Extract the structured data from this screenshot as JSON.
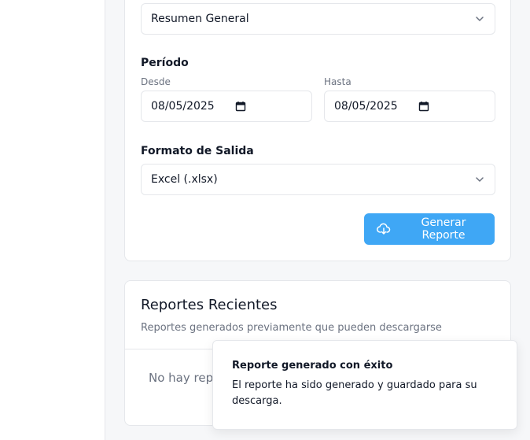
{
  "report": {
    "type_value": "Resumen General",
    "period_label": "Período",
    "from_label": "Desde",
    "from_value": "08/05/2025",
    "to_label": "Hasta",
    "to_value": "08/05/2025",
    "format_label": "Formato de Salida",
    "format_value": "Excel (.xlsx)",
    "generate_label": "Generar Reporte"
  },
  "recent": {
    "title": "Reportes Recientes",
    "subtitle": "Reportes generados previamente que pueden descargarse",
    "empty_text": "No hay repo"
  },
  "toast": {
    "title": "Reporte generado con éxito",
    "description": "El reporte ha sido generado y guardado para su descarga."
  },
  "colors": {
    "accent": "#3fa7f5",
    "border": "#e5e7eb",
    "muted_text": "#6b7280"
  },
  "icons": {
    "chevron": "chevron-down-icon",
    "calendar": "calendar-icon",
    "cloud": "cloud-download-icon"
  }
}
